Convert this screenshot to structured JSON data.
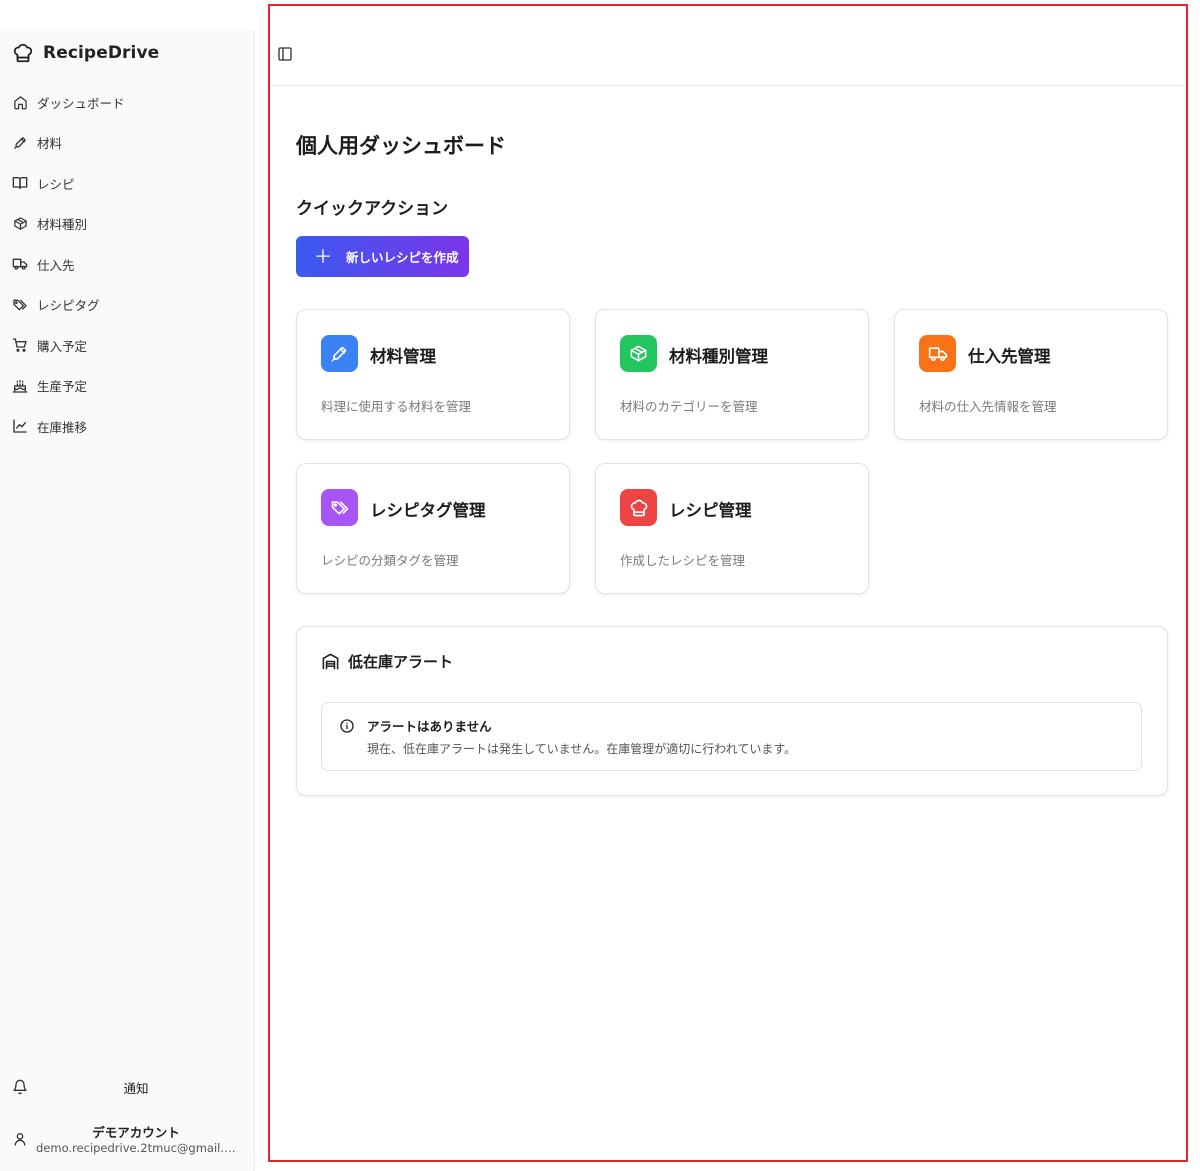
{
  "app": {
    "name": "RecipeDrive"
  },
  "sidebar": {
    "items": [
      {
        "label": "ダッシュボード",
        "icon": "home-icon"
      },
      {
        "label": "材料",
        "icon": "pen-icon"
      },
      {
        "label": "レシピ",
        "icon": "book-icon"
      },
      {
        "label": "材料種別",
        "icon": "box-icon"
      },
      {
        "label": "仕入先",
        "icon": "truck-icon"
      },
      {
        "label": "レシピタグ",
        "icon": "tags-icon"
      },
      {
        "label": "購入予定",
        "icon": "cart-icon"
      },
      {
        "label": "生産予定",
        "icon": "cake-icon"
      },
      {
        "label": "在庫推移",
        "icon": "chart-icon"
      }
    ],
    "notifications_label": "通知",
    "account": {
      "name": "デモアカウント",
      "email": "demo.recipedrive.2tmuc@gmail.c..."
    }
  },
  "main": {
    "title": "個人用ダッシュボード",
    "quick_actions_title": "クイックアクション",
    "new_recipe_button": "新しいレシピを作成",
    "cards": [
      {
        "title": "材料管理",
        "desc": "料理に使用する材料を管理",
        "color": "#3b82f6",
        "icon": "pen-icon"
      },
      {
        "title": "材料種別管理",
        "desc": "材料のカテゴリーを管理",
        "color": "#22c55e",
        "icon": "box-icon"
      },
      {
        "title": "仕入先管理",
        "desc": "材料の仕入先情報を管理",
        "color": "#f97316",
        "icon": "truck-icon"
      },
      {
        "title": "レシピタグ管理",
        "desc": "レシピの分類タグを管理",
        "color": "#a855f7",
        "icon": "tags-icon"
      },
      {
        "title": "レシピ管理",
        "desc": "作成したレシピを管理",
        "color": "#ef4444",
        "icon": "chef-hat-icon"
      }
    ],
    "low_stock": {
      "title": "低在庫アラート",
      "alert_title": "アラートはありません",
      "alert_desc": "現在、低在庫アラートは発生していません。在庫管理が適切に行われています。"
    }
  }
}
